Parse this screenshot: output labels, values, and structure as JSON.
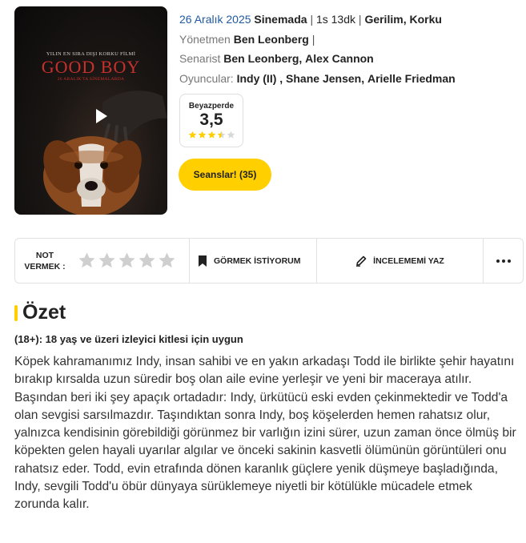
{
  "poster": {
    "tagline": "YILIN EN SIRA DIŞI KORKU FİLMİ",
    "title": "GOOD BOY",
    "date_line": "26 ARALIK'TA SİNEMALARDA",
    "play_icon": "play-icon"
  },
  "info": {
    "release_date": "26 Aralık 2025",
    "status": "Sinemada",
    "separator": "|",
    "duration": "1s 13dk",
    "genres": [
      "Gerilim",
      "Korku"
    ],
    "director_label": "Yönetmen",
    "director": "Ben Leonberg",
    "writer_label": "Senarist",
    "writers": [
      "Ben Leonberg",
      "Alex Cannon"
    ],
    "cast_label": "Oyuncular:",
    "cast": [
      "Indy (II)",
      "Shane Jensen",
      "Arielle Friedman"
    ]
  },
  "rating": {
    "label": "Beyazperde",
    "value": "3,5",
    "stars": 3.5,
    "max": 5,
    "star_color": "#ffcf00"
  },
  "seans_button": "Seanslar! (35)",
  "action_bar": {
    "not_label_line1": "NOT",
    "not_label_line2": "VERMEK :",
    "rating_stars": 5,
    "watch_label": "GÖRMEK İSTİYORUM",
    "review_label": "İNCELEMEMİ YAZ",
    "more_icon": "more-dots-icon"
  },
  "summary": {
    "title": "Özet",
    "age_note": "(18+): 18 yaş ve üzeri izleyici kitlesi için uygun",
    "text": "Köpek kahramanımız Indy, insan sahibi ve en yakın arkadaşı Todd ile birlikte şehir hayatını bırakıp kırsalda uzun süredir boş olan aile evine yerleşir ve yeni bir maceraya atılır. Başından beri iki şey apaçık ortadadır: Indy, ürkütücü eski evden çekinmektedir ve Todd'a olan sevgisi sarsılmazdır. Taşındıktan sonra Indy, boş köşelerden hemen rahatsız olur, yalnızca kendisinin görebildiği görünmez bir varlığın izini sürer, uzun zaman önce ölmüş bir köpekten gelen hayali uyarılar algılar ve önceki sakinin kasvetli ölümünün görüntüleri onu rahatsız eder. Todd, evin etrafında dönen karanlık güçlere yenik düşmeye başladığında, Indy, sevgili Todd'u öbür dünyaya sürüklemeye niyetli bir kötülükle mücadele etmek zorunda kalır."
  }
}
